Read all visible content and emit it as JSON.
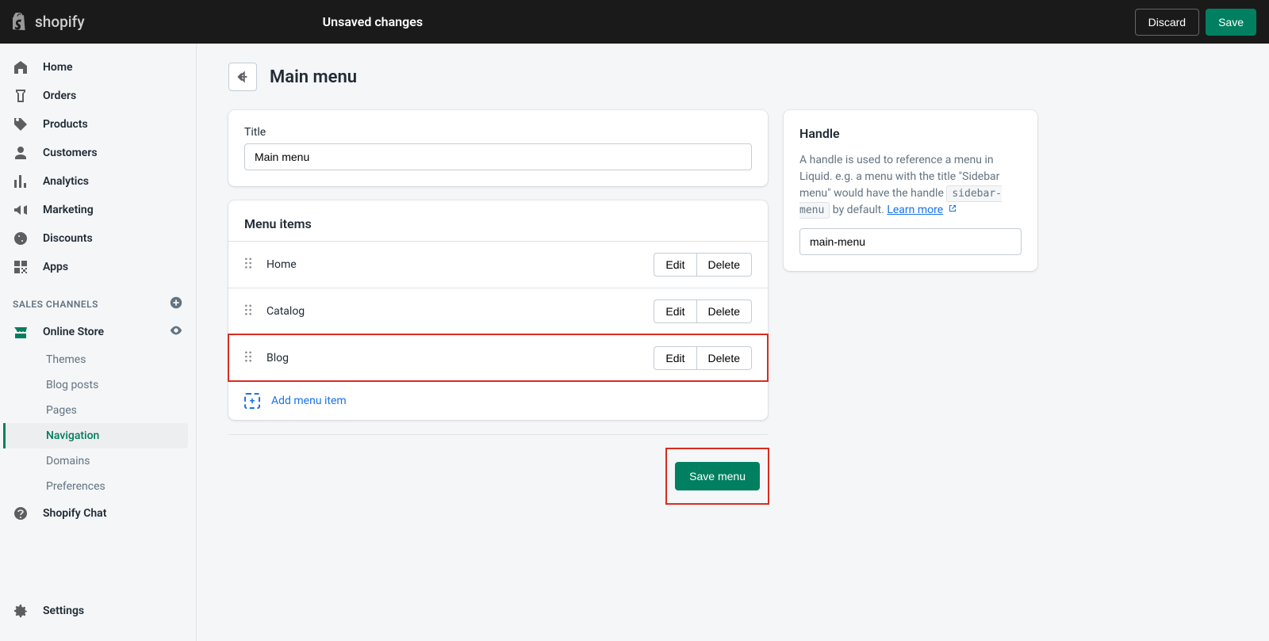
{
  "topbar": {
    "logo_text": "shopify",
    "status": "Unsaved changes",
    "discard": "Discard",
    "save": "Save"
  },
  "sidebar": {
    "items": [
      {
        "label": "Home",
        "icon": "home"
      },
      {
        "label": "Orders",
        "icon": "orders"
      },
      {
        "label": "Products",
        "icon": "products"
      },
      {
        "label": "Customers",
        "icon": "customers"
      },
      {
        "label": "Analytics",
        "icon": "analytics"
      },
      {
        "label": "Marketing",
        "icon": "marketing"
      },
      {
        "label": "Discounts",
        "icon": "discounts"
      },
      {
        "label": "Apps",
        "icon": "apps"
      }
    ],
    "section_label": "SALES CHANNELS",
    "online_store": "Online Store",
    "subitems": [
      {
        "label": "Themes"
      },
      {
        "label": "Blog posts"
      },
      {
        "label": "Pages"
      },
      {
        "label": "Navigation",
        "active": true
      },
      {
        "label": "Domains"
      },
      {
        "label": "Preferences"
      }
    ],
    "shopify_chat": "Shopify Chat",
    "settings": "Settings"
  },
  "page": {
    "title": "Main menu",
    "title_label": "Title",
    "title_value": "Main menu",
    "menu_items_heading": "Menu items",
    "menu_items": [
      {
        "name": "Home"
      },
      {
        "name": "Catalog"
      },
      {
        "name": "Blog",
        "highlighted": true
      }
    ],
    "edit_label": "Edit",
    "delete_label": "Delete",
    "add_item": "Add menu item",
    "save_menu": "Save menu"
  },
  "handle": {
    "heading": "Handle",
    "description_pre": "A handle is used to reference a menu in Liquid. e.g. a menu with the title \"Sidebar menu\" would have the handle ",
    "code": "sidebar-menu",
    "description_mid": " by default. ",
    "learn_more": "Learn more",
    "value": "main-menu"
  }
}
